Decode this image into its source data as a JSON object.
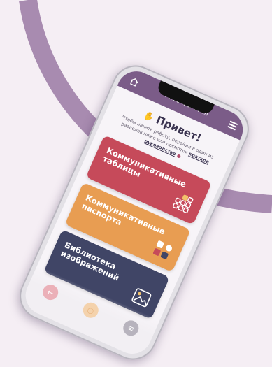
{
  "app": {
    "title": "Рабочий стол"
  },
  "greeting": {
    "title": "Привет!"
  },
  "intro": {
    "text": "Чтобы начать работу, перейди в один из разделов ниже или посмотри",
    "link": "краткое руководство"
  },
  "cards": [
    {
      "label": "Коммуникативные таблицы",
      "color": "#c64a5a"
    },
    {
      "label": "Коммуникативные паспорта",
      "color": "#e89d52"
    },
    {
      "label": "Библиотека изображений",
      "color": "#404566"
    }
  ],
  "colors": {
    "topbar": "#7b5c88",
    "background": "#f5eef4",
    "arc": "#a88bb0"
  }
}
